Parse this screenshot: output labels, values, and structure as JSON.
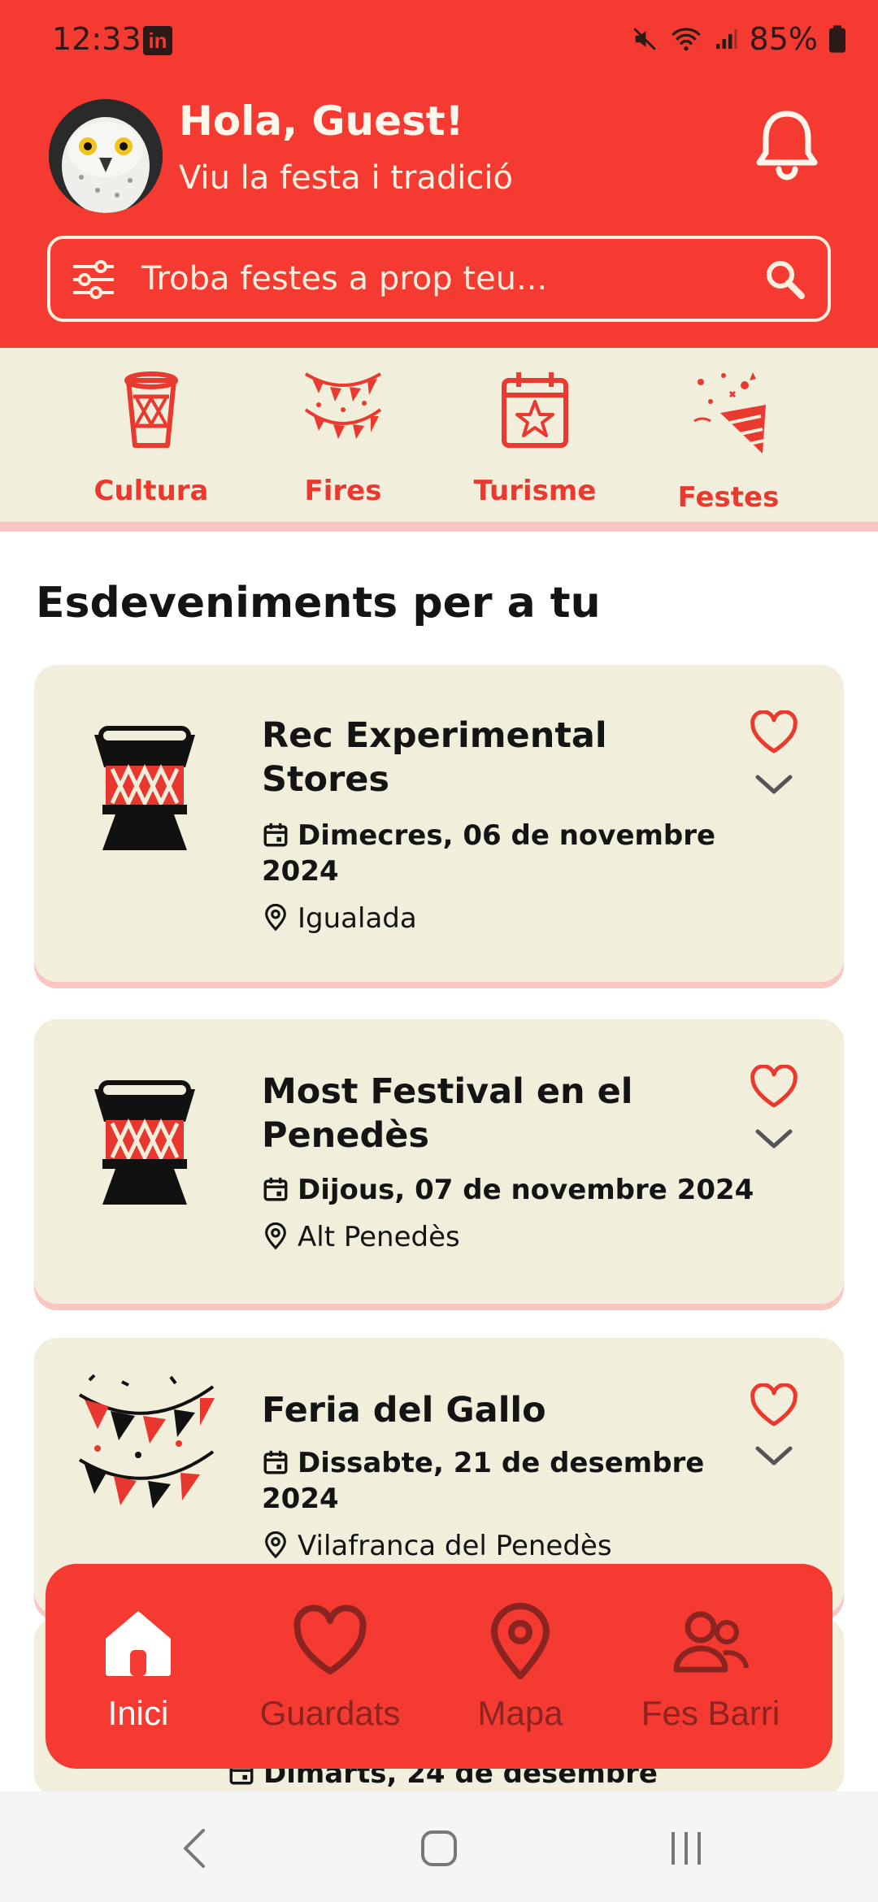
{
  "status_bar": {
    "time": "12:33",
    "battery": "85%"
  },
  "header": {
    "greeting": "Hola, Guest!",
    "subtitle": "Viu la festa i tradició"
  },
  "search": {
    "placeholder": "Troba festes a prop teu..."
  },
  "categories": [
    {
      "label": "Cultura",
      "icon": "drum-icon"
    },
    {
      "label": "Fires",
      "icon": "bunting-icon"
    },
    {
      "label": "Turisme",
      "icon": "calendar-star-icon"
    },
    {
      "label": "Festes",
      "icon": "party-popper-icon"
    }
  ],
  "section_title": "Esdeveniments per a tu",
  "events": [
    {
      "title": "Rec Experimental Stores",
      "date": "Dimecres, 06 de novembre 2024",
      "location": "Igualada",
      "icon": "drum-icon"
    },
    {
      "title": "Most Festival en el Penedès",
      "date": "Dijous, 07 de novembre 2024",
      "location": "Alt Penedès",
      "icon": "drum-icon"
    },
    {
      "title": "Feria del Gallo",
      "date": "Dissabte, 21 de desembre 2024",
      "location": "Vilafranca del Penedès",
      "icon": "bunting-icon"
    },
    {
      "title": "",
      "date": "Dimarts, 24 de desembre",
      "location": "",
      "icon": "drum-icon"
    }
  ],
  "bottom_nav": [
    {
      "label": "Inici",
      "icon": "home-icon",
      "active": true
    },
    {
      "label": "Guardats",
      "icon": "heart-icon",
      "active": false
    },
    {
      "label": "Mapa",
      "icon": "map-pin-icon",
      "active": false
    },
    {
      "label": "Fes Barri",
      "icon": "users-icon",
      "active": false
    }
  ],
  "colors": {
    "primary": "#f43a31",
    "cream": "#f1efdc",
    "accent_red": "#ea3a2f",
    "shadow_pink": "#f9c6c1"
  }
}
